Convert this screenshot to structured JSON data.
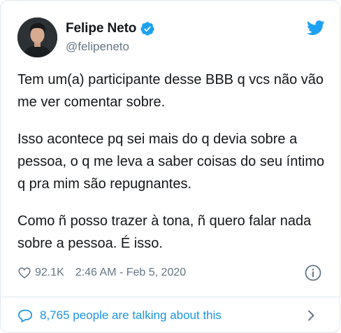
{
  "user": {
    "display_name": "Felipe Neto",
    "handle": "@felipeneto",
    "verified": true
  },
  "icons": {
    "verified": "verified-badge-icon",
    "brand": "twitter-bird-icon",
    "like": "heart-icon",
    "info": "info-icon",
    "reply": "speech-bubble-icon",
    "chevron": "chevron-right-icon"
  },
  "tweet": {
    "paragraphs": [
      "Tem um(a) participante desse BBB q vcs não vão me ver comentar sobre.",
      "Isso acontece pq sei mais do q devia sobre a pessoa, o q me leva a saber coisas do seu íntimo q pra mim são repugnantes.",
      "Como ñ posso trazer à tona, ñ quero falar nada sobre a pessoa. É isso."
    ],
    "like_count": "92.1K",
    "timestamp": "2:46 AM - Feb 5, 2020"
  },
  "footer": {
    "label": "8,765 people are talking about this"
  },
  "colors": {
    "primary_text": "#14171a",
    "secondary_text": "#657786",
    "accent": "#1da1f2",
    "link": "#1b95e0",
    "border": "#e1e8ed"
  }
}
